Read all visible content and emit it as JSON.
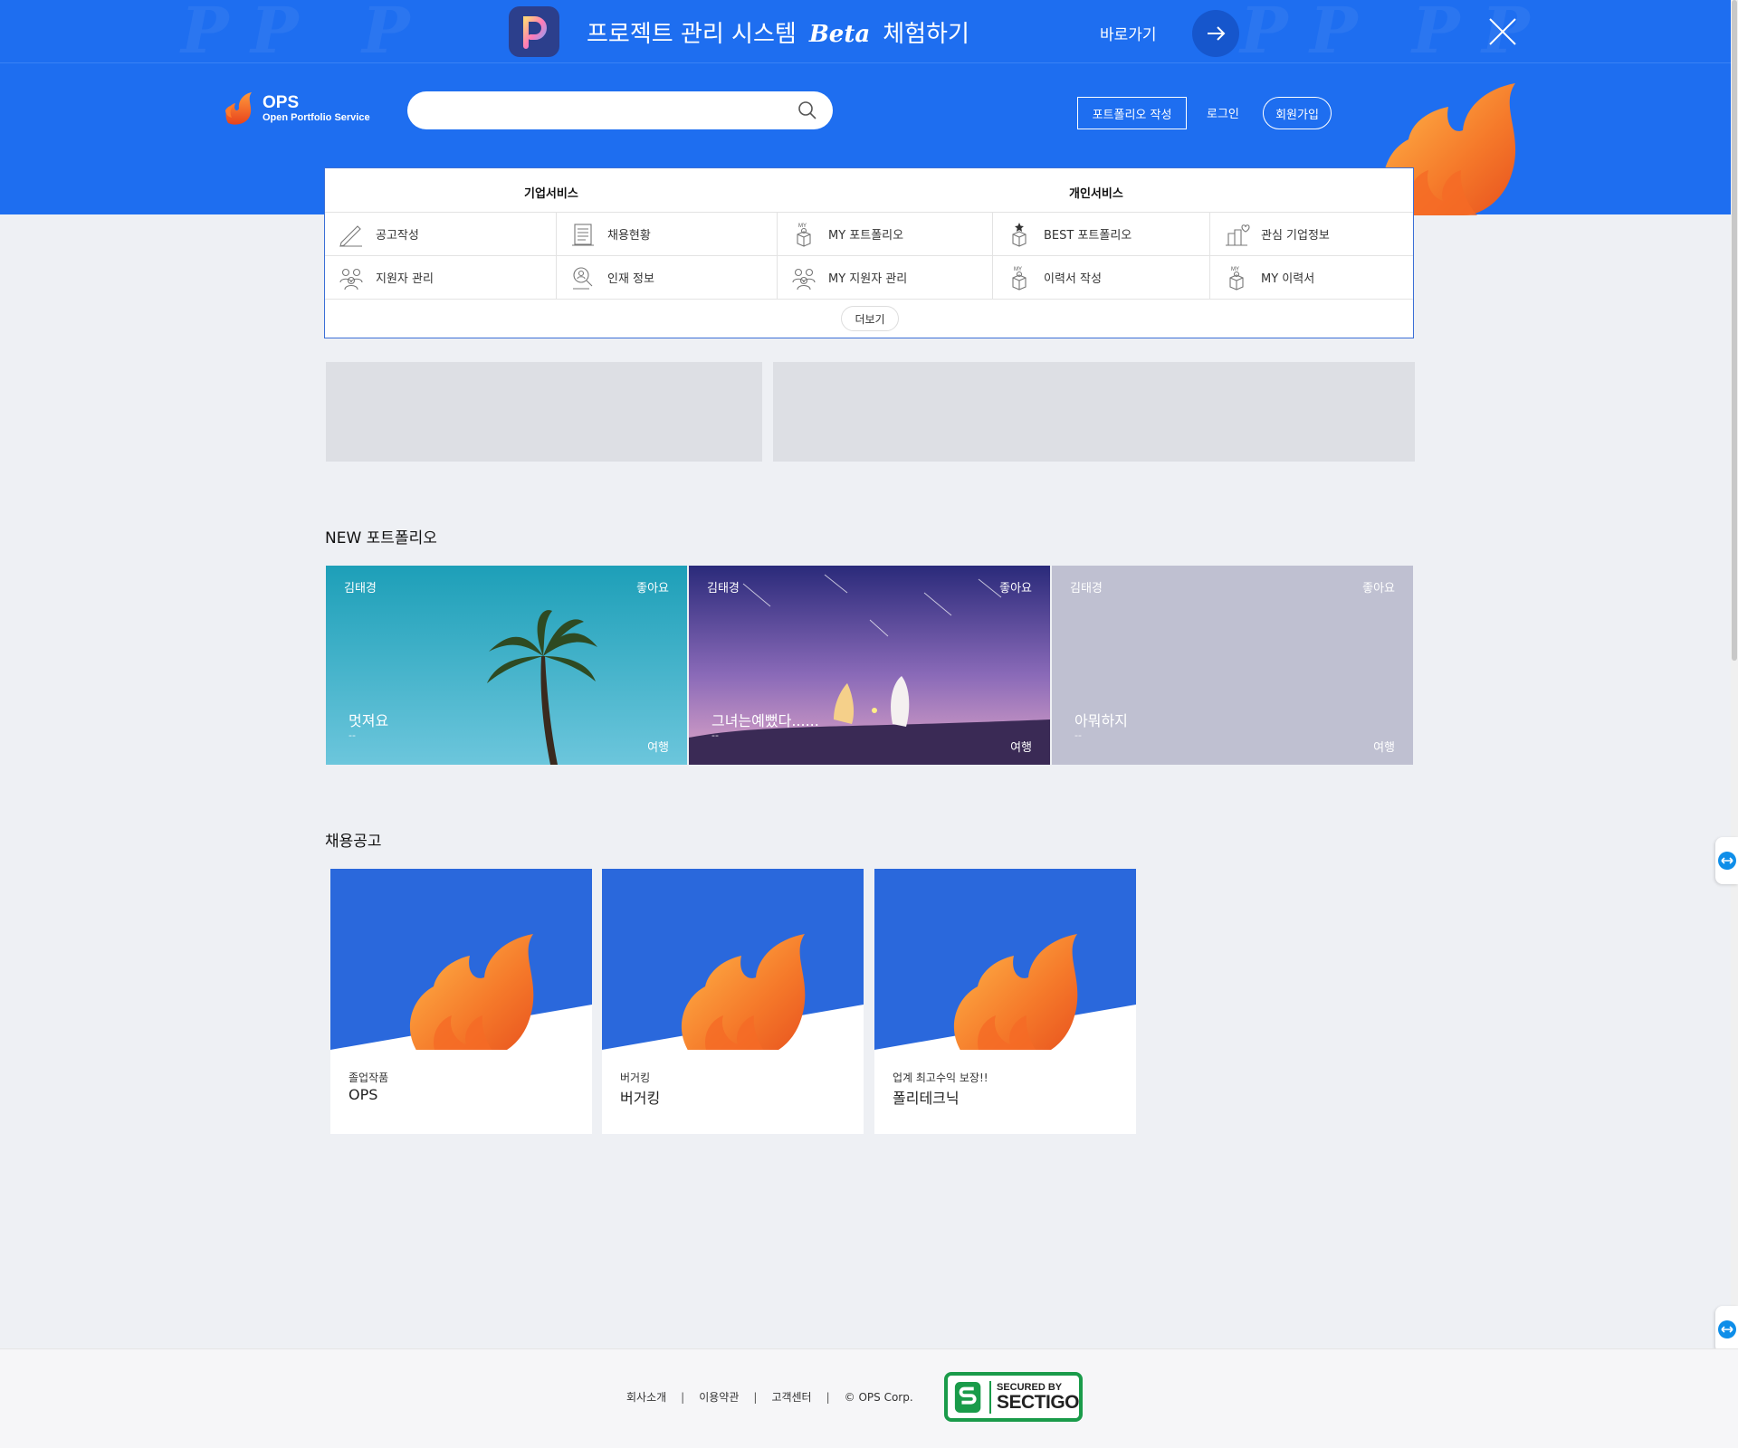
{
  "promo": {
    "text_before": "프로젝트 관리 시스템",
    "beta": "Beta",
    "text_after": "체험하기",
    "go_label": "바로가기",
    "app_icon": "p-app-icon"
  },
  "header": {
    "logo_name": "OPS",
    "logo_sub": "Open Portfolio Service",
    "search_placeholder": "",
    "write_label": "포트폴리오 작성",
    "login_label": "로그인",
    "join_label": "회원가입"
  },
  "services": {
    "corp_title": "기업서비스",
    "personal_title": "개인서비스",
    "rows": [
      [
        {
          "label": "공고작성",
          "icon": "pencil-icon"
        },
        {
          "label": "채용현황",
          "icon": "document-icon"
        },
        {
          "label": "MY 포트폴리오",
          "icon": "my-box-icon"
        },
        {
          "label": "BEST 포트폴리오",
          "icon": "star-box-icon"
        },
        {
          "label": "관심 기업정보",
          "icon": "building-heart-icon"
        }
      ],
      [
        {
          "label": "지원자 관리",
          "icon": "people-icon"
        },
        {
          "label": "인재 정보",
          "icon": "person-search-icon"
        },
        {
          "label": "MY 지원자 관리",
          "icon": "people-icon"
        },
        {
          "label": "이력서 작성",
          "icon": "my-box-icon"
        },
        {
          "label": "MY 이력서",
          "icon": "my-box-icon"
        }
      ]
    ],
    "more_label": "더보기"
  },
  "portfolio": {
    "title": "NEW 포트폴리오",
    "items": [
      {
        "author": "김태경",
        "like": "좋아요",
        "title": "멋져요",
        "sub": "--",
        "category": "여행",
        "bg": "palm"
      },
      {
        "author": "김태경",
        "like": "좋아요",
        "title": "그녀는예뻤다......",
        "sub": "--",
        "category": "여행",
        "bg": "night"
      },
      {
        "author": "김태경",
        "like": "좋아요",
        "title": "아뭐하지",
        "sub": "--",
        "category": "여행",
        "bg": "plain"
      }
    ]
  },
  "jobs": {
    "title": "채용공고",
    "items": [
      {
        "desc": "졸업작품",
        "name": "OPS"
      },
      {
        "desc": "버거킹",
        "name": "버거킹"
      },
      {
        "desc": "업계 최고수익 보장!!",
        "name": "폴리테크닉"
      }
    ]
  },
  "footer": {
    "links": [
      "회사소개",
      "이용약관",
      "고객센터"
    ],
    "copyright": "© OPS Corp.",
    "badge_line1": "SECURED BY",
    "badge_line2": "SECTIGO"
  },
  "colors": {
    "brand_blue": "#1e6ef0",
    "flame_orange": "#f5792a",
    "job_blue": "#2a68dc"
  }
}
